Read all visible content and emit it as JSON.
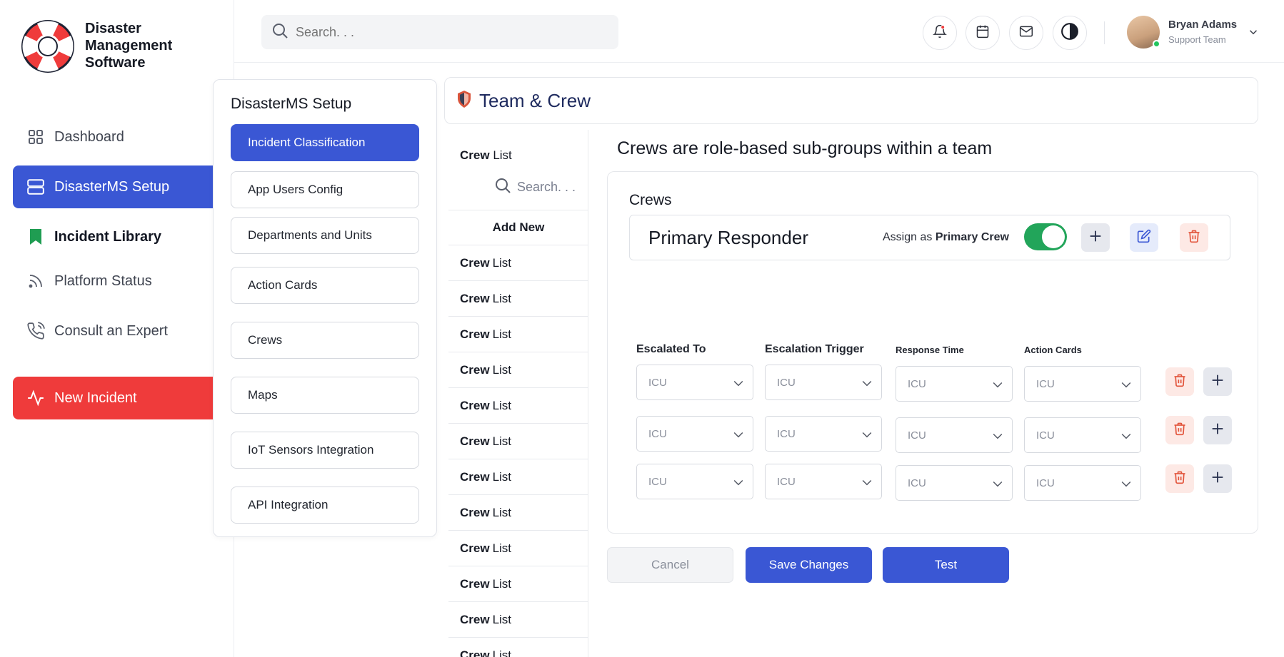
{
  "app": {
    "logo_line1": "Disaster",
    "logo_line2": "Management",
    "logo_line3": "Software"
  },
  "sidebar": {
    "items": [
      {
        "label": "Dashboard"
      },
      {
        "label": "DisasterMS Setup"
      },
      {
        "label": "Incident Library"
      },
      {
        "label": "Platform Status"
      },
      {
        "label": "Consult an Expert"
      },
      {
        "label": "New Incident"
      }
    ]
  },
  "header": {
    "search_placeholder": "Search. . .",
    "user_name": "Bryan Adams",
    "user_role": "Support Team"
  },
  "setup": {
    "title": "DisasterMS Setup",
    "items": [
      "Incident Classification",
      "App Users Config",
      "Departments and  Units",
      "Action Cards",
      "Crews",
      "Maps",
      "IoT Sensors Integration",
      "API Integration"
    ]
  },
  "page": {
    "title": "Team & Crew",
    "heading": "Crews are role-based sub-groups within a team"
  },
  "crew_list": {
    "header": "Crew List",
    "search_placeholder": "Search. . .",
    "add_new": "Add New",
    "row_bold": "Crew",
    "row_rest": "List"
  },
  "crews": {
    "label": "Crews",
    "primary_name": "Primary Responder",
    "assign_prefix": "Assign as ",
    "assign_bold": "Primary Crew",
    "toggle_on": true,
    "columns": [
      "Escalated To",
      "Escalation Trigger",
      "Response Time",
      "Action Cards"
    ],
    "rows": [
      [
        "ICU",
        "ICU",
        "ICU",
        "ICU"
      ],
      [
        "ICU",
        "ICU",
        "ICU",
        "ICU"
      ],
      [
        "ICU",
        "ICU",
        "ICU",
        "ICU"
      ]
    ]
  },
  "footer": {
    "cancel": "Cancel",
    "save": "Save Changes",
    "test": "Test"
  },
  "colors": {
    "primary": "#3a57d4",
    "danger": "#ef3b3b",
    "success": "#22a55a"
  }
}
